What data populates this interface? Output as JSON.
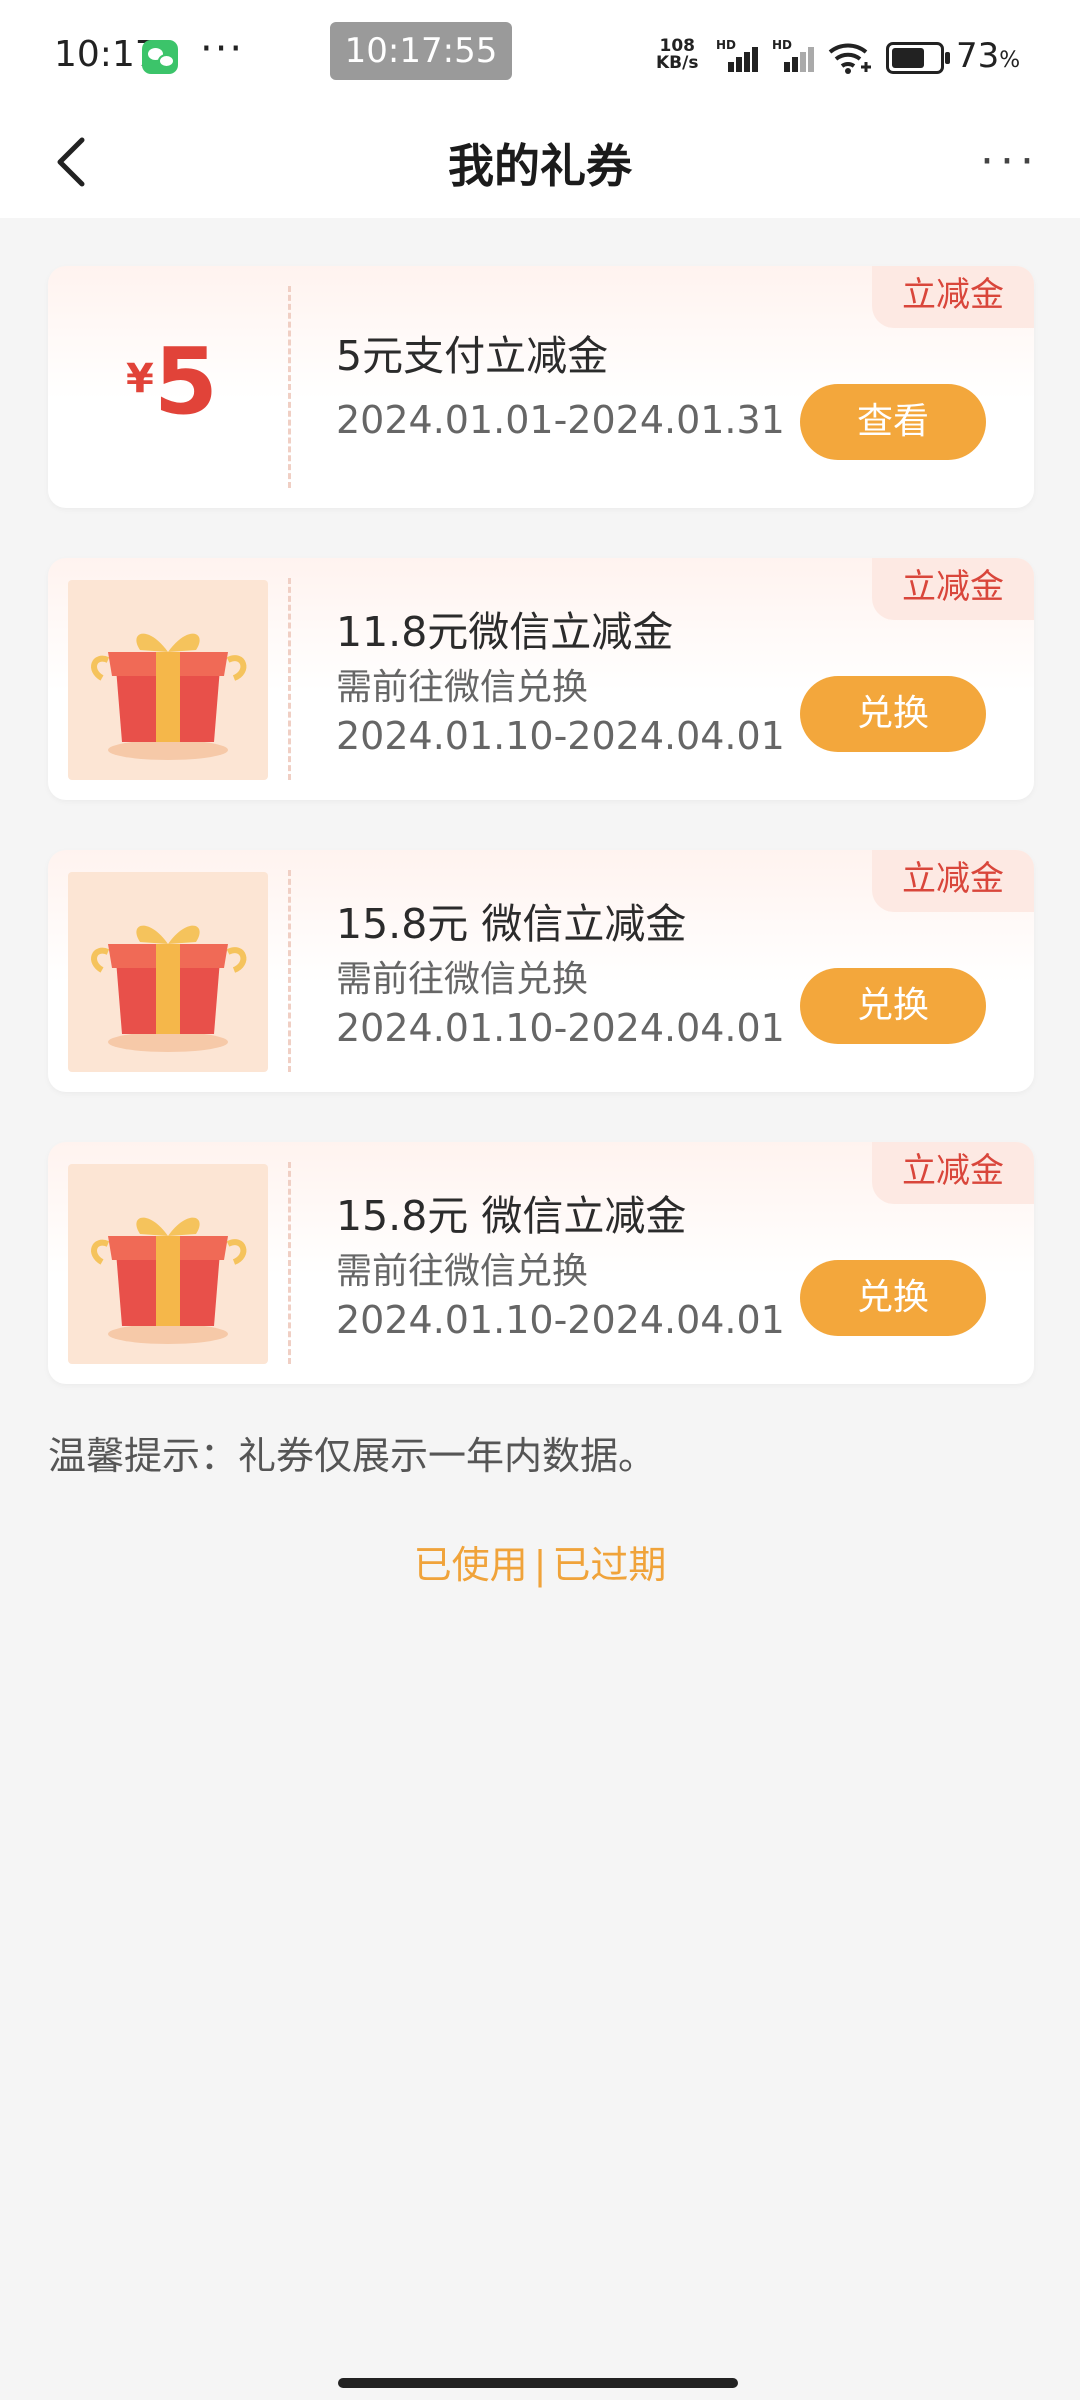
{
  "status_bar": {
    "time": "10:17",
    "dots": "···",
    "clock": "10:17:55",
    "net_speed_value": "108",
    "net_speed_unit": "KB/s",
    "hd1": "HD",
    "hd2": "HD",
    "battery_pct": "73",
    "battery_unit": "%"
  },
  "nav": {
    "title": "我的礼券",
    "more": "···"
  },
  "coupons": [
    {
      "tag": "立减金",
      "yen": "¥",
      "amount": "5",
      "title": "5元支付立减金",
      "date": "2024.01.01-2024.01.31",
      "button": "查看"
    },
    {
      "tag": "立减金",
      "title": "11.8元微信立减金",
      "subtitle": "需前往微信兑换",
      "date": "2024.01.10-2024.04.01",
      "button": "兑换"
    },
    {
      "tag": "立减金",
      "title": "15.8元 微信立减金",
      "subtitle": "需前往微信兑换",
      "date": "2024.01.10-2024.04.01",
      "button": "兑换"
    },
    {
      "tag": "立减金",
      "title": "15.8元 微信立减金",
      "subtitle": "需前往微信兑换",
      "date": "2024.01.10-2024.04.01",
      "button": "兑换"
    }
  ],
  "tip": "温馨提示：礼券仅展示一年内数据。",
  "footer_links": {
    "used": "已使用",
    "separator": "|",
    "expired": "已过期"
  },
  "colors": {
    "accent_orange": "#f3a73c",
    "tag_red": "#d9463b",
    "amount_red": "#e14339",
    "link_orange": "#f0a33a"
  },
  "icons": [
    "wechat-icon",
    "signal-icon",
    "wifi-icon",
    "battery-icon",
    "back-icon",
    "more-icon",
    "gift-box-icon"
  ]
}
